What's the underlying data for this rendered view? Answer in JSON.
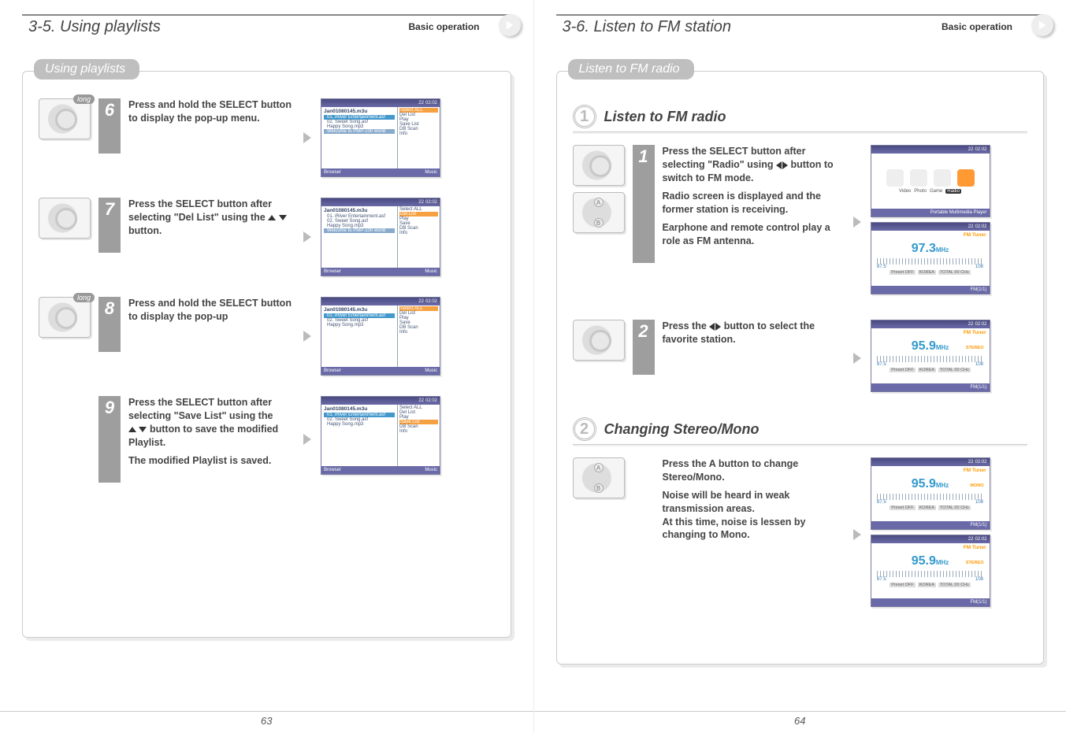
{
  "left": {
    "header_title": "3-5. Using playlists",
    "header_op": "Basic operation",
    "panel_tab": "Using playlists",
    "page_no": "63",
    "steps": [
      {
        "num": "6",
        "long": true,
        "text": "Press and hold the SELECT button to display the pop-up menu.",
        "popup_highlight": "Select ALL",
        "popup_items": [
          "Del List",
          "Play",
          "Save List",
          "DB Scan",
          "Info"
        ]
      },
      {
        "num": "7",
        "long": false,
        "text_pre": "Press the SELECT button after selecting \"Del List\" using the ",
        "text_post": " button.",
        "arrows": "ud",
        "popup_top": "Select ALL",
        "popup_highlight": "Del List",
        "popup_items": [
          "Play",
          "Save",
          "DB Scan",
          "Info"
        ]
      },
      {
        "num": "8",
        "long": true,
        "text": "Press and hold the SELECT button to display the pop-up",
        "popup_highlight": "Select ALL",
        "popup_items": [
          "Del List",
          "Play",
          "Save",
          "DB Scan",
          "Info"
        ]
      },
      {
        "num": "9",
        "long": false,
        "text_pre": "Press the SELECT button after selecting \"Save List\" using the ",
        "text_post": " button to save the modified Playlist.",
        "arrows": "ud",
        "sub": "The modified Playlist is saved.",
        "popup_top": "Select ALL",
        "popup_top2": "Del List",
        "popup_top3": "Play",
        "popup_highlight": "Save List",
        "popup_items": [
          "DB Scan",
          "Info"
        ]
      }
    ],
    "screenshot_common": {
      "time": "02:02",
      "battery": "22",
      "file": "Jan01080145.m3u",
      "tracks": [
        "01. iRiver Entertainment.asf",
        "02. Sweet Song.asf",
        "Happy Song.mp3",
        "Welcome to PMP-100 world"
      ],
      "footer_left": "Browser",
      "footer_right": "Music"
    }
  },
  "right": {
    "header_title": "3-6. Listen to FM station",
    "header_op": "Basic operation",
    "panel_tab": "Listen to FM radio",
    "page_no": "64",
    "section1": {
      "circ": "1",
      "title": "Listen to FM radio",
      "step1": {
        "num": "1",
        "line1_pre": "Press the SELECT button after selecting \"Radio\" using ",
        "line1_post": " button to switch to FM mode.",
        "line2": "Radio screen is displayed and the former station is receiving.",
        "line3": "Earphone and remote control play a role as FM antenna.",
        "home_labels": [
          "Video",
          "Photo",
          "Game",
          "Radio"
        ],
        "home_footer": "Portable Multimedia Player",
        "fm_freq": "97.3"
      },
      "step2": {
        "num": "2",
        "text_pre": "Press the ",
        "text_post": " button to select the favorite station.",
        "fm_freq": "95.9"
      }
    },
    "section2": {
      "circ": "2",
      "title": "Changing Stereo/Mono",
      "step": {
        "line1": "Press the A button to change Stereo/Mono.",
        "line2": "Noise will be heard in weak transmission areas.",
        "line3": "At this time, noise is lessen by changing to Mono.",
        "fm_freq": "95.9"
      }
    },
    "fm_common": {
      "time": "02:02",
      "battery": "22",
      "label_top": "FM Tuner",
      "stereo": "STEREO",
      "mono": "MONO",
      "unit": "MHz",
      "scale_lo": "87.5",
      "scale_hi": "108",
      "sub1": "Preset OFF",
      "sub2": "KOREA",
      "sub3": "TOTAL 00 CHs",
      "footer": "FM(1/1)"
    }
  }
}
